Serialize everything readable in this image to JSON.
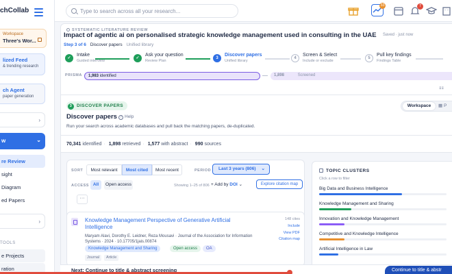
{
  "app": {
    "brand": "chCollab"
  },
  "search": {
    "placeholder": "Type to search across all your research..."
  },
  "topbar": {
    "notif_a": "33",
    "notif_b": "7"
  },
  "sidebar": {
    "workspace_label": "Workspace",
    "workspace_name": "Three's Wor...",
    "cards": [
      {
        "title": "lized Feed",
        "sub": "& trending research"
      },
      {
        "title": "ch Agent",
        "sub": "paper generation"
      }
    ],
    "active": "w",
    "submenu": [
      "re Review",
      "sight",
      "Diagram",
      "ed Papers"
    ],
    "section": "TOOLS",
    "recent": [
      "e Projects",
      "ration"
    ]
  },
  "header": {
    "crumb": "SYSTEMATIC LITERATURE REVIEW",
    "title": "Impact of agentic ai on personalised strategic knowledge management used in consulting in the UAE",
    "saved": "Saved · just now",
    "step_of": "Step 3 of 6",
    "step_name": "Discover papers",
    "step_scope": "Unified library"
  },
  "steps": [
    {
      "num": "✓",
      "label": "Intake",
      "sub": "Guided interview",
      "state": "done"
    },
    {
      "num": "✓",
      "label": "Ask your question",
      "sub": "Review Plan",
      "state": "done"
    },
    {
      "num": "3",
      "label": "Discover papers",
      "sub": "Unified library",
      "state": "cur"
    },
    {
      "num": "4",
      "label": "Screen & Select",
      "sub": "Include or exclude",
      "state": "todo"
    },
    {
      "num": "5",
      "label": "Pull key findings",
      "sub": "Findings Table",
      "state": "todo"
    }
  ],
  "prisma": {
    "label": "PRISMA",
    "identified_count": "1,983",
    "identified_text": "identified",
    "screened_count": "1,898",
    "screened_text": "Screened"
  },
  "section": {
    "chip_num": "3",
    "chip": "DISCOVER PAPERS",
    "title": "Discover papers",
    "help": "Help",
    "desc": "Run your search across academic databases and pull back the matching papers, de-duplicated."
  },
  "view": {
    "active": "Workspace",
    "other": "P"
  },
  "stats": {
    "identified": "70,341",
    "identified_l": "identified",
    "retrieved": "1,898",
    "retrieved_l": "retrieved",
    "abstract": "1,577",
    "abstract_l": "with abstract",
    "sources": "990",
    "sources_l": "sources"
  },
  "filters": {
    "sort_label": "SORT",
    "sort_options": [
      "Most relevant",
      "Most cited",
      "Most recent"
    ],
    "period_label": "PERIOD",
    "period_value": "Last 3 years (806)",
    "access_label": "ACCESS",
    "access_options": [
      "All",
      "Open access"
    ],
    "showing": "Showing 1–25 of 806",
    "add_by": "+ Add by",
    "add_by_doi": "DOI",
    "explore": "Explore citation map",
    "more": "···"
  },
  "paper": {
    "title": "Knowledge Management Perspective of Generative Artificial Intelligence",
    "authors": "Maryam Alavi, Dorothy E. Leidner, Reza Mousavi · Journal of the Association for Information Systems · 2024 · 10.17705/1jais.00874",
    "tags": [
      "Knowledge Management and Sharing",
      "Open access",
      "OA"
    ],
    "types": [
      "Journal",
      "Article"
    ],
    "cites": "148 cites",
    "actions": [
      "Include",
      "View PDF",
      "Citation map"
    ]
  },
  "clusters": {
    "title": "TOPIC CLUSTERS",
    "sub": "Click a row to filter",
    "items": [
      {
        "name": "Big Data and Business Intelligence",
        "share": 0.65,
        "color": "#2f6fe4"
      },
      {
        "name": "Knowledge Management and Sharing",
        "share": 0.25,
        "color": "#1e9e5a"
      },
      {
        "name": "Innovation and Knowledge Management",
        "share": 0.2,
        "color": "#8b5cf6"
      },
      {
        "name": "Competitive and Knowledge Intelligence",
        "share": 0.2,
        "color": "#e8902f"
      },
      {
        "name": "Artificial Intelligence in Law",
        "share": 0.15,
        "color": "#2f6fe4"
      }
    ]
  },
  "footer": {
    "next_prefix": "Next:",
    "next_text": "Continue to title & abstract screening",
    "cta": "Continue to title & abstr"
  }
}
